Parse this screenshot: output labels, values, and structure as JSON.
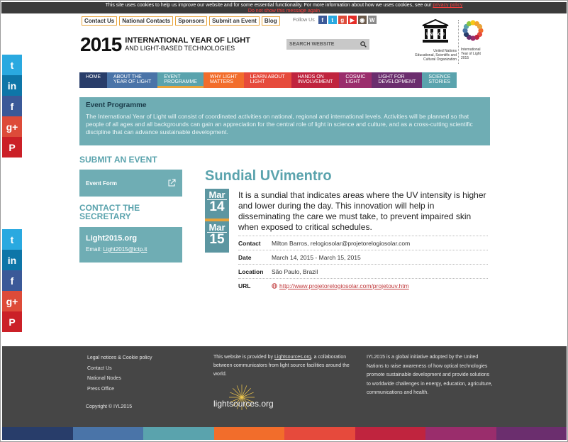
{
  "cookie": {
    "text": "This site uses cookies to help us improve our website and for some essential functionality. For more information about how we uses cookies, see our",
    "policy_link": "privacy policy",
    "dismiss": "Do not show this message again"
  },
  "top_links": [
    "Contact Us",
    "National Contacts",
    "Sponsors",
    "Submit an Event",
    "Blog"
  ],
  "follow": {
    "label": "Follow Us",
    "icons": [
      {
        "name": "facebook-icon",
        "glyph": "f",
        "color": "#3b5998"
      },
      {
        "name": "twitter-icon",
        "glyph": "t",
        "color": "#2aa9e0"
      },
      {
        "name": "google-plus-icon",
        "glyph": "g",
        "color": "#dd4b39"
      },
      {
        "name": "youtube-icon",
        "glyph": "▶",
        "color": "#e52d27"
      },
      {
        "name": "instagram-icon",
        "glyph": "◉",
        "color": "#6b5a4b"
      },
      {
        "name": "wordpress-icon",
        "glyph": "W",
        "color": "#8a8a8a"
      }
    ]
  },
  "logo": {
    "year": "2015",
    "line1": "INTERNATIONAL YEAR OF LIGHT",
    "line2": "AND LIGHT-BASED TECHNOLOGIES"
  },
  "search": {
    "placeholder": "SEARCH WEBSITE"
  },
  "unesco": {
    "word": "UNESCO",
    "caption_1": "United Nations",
    "caption_2": "Educational, Scientific and",
    "caption_3": "Cultural Organization"
  },
  "iyl_logo": {
    "caption_1": "International",
    "caption_2": "Year of Light",
    "caption_3": "2015"
  },
  "nav": [
    {
      "l1": "HOME",
      "l2": "",
      "color": "#283d6a"
    },
    {
      "l1": "ABOUT THE",
      "l2": "YEAR OF LIGHT",
      "color": "#4a74a8"
    },
    {
      "l1": "EVENT",
      "l2": "PROGRAMME",
      "color": "#5aa3ad"
    },
    {
      "l1": "WHY LIGHT",
      "l2": "MATTERS",
      "color": "#f26d2b"
    },
    {
      "l1": "LEARN ABOUT",
      "l2": "LIGHT",
      "color": "#e64a3c"
    },
    {
      "l1": "HANDS ON",
      "l2": "INVOLVEMENT",
      "color": "#c0243e"
    },
    {
      "l1": "COSMIC",
      "l2": "LIGHT",
      "color": "#9a2d6c"
    },
    {
      "l1": "LIGHT FOR",
      "l2": "DEVELOPMENT",
      "color": "#6b2e6e"
    },
    {
      "l1": "SCIENCE",
      "l2": "STORIES",
      "color": "#5aa3ad"
    }
  ],
  "intro": {
    "title": "Event Programme",
    "body": "The International Year of Light will consist of coordinated activities on national, regional and international levels. Activities will be planned so that people of all ages and all backgrounds can gain an appreciation for the central role of light in science and culture, and as a cross-cutting scientific discipline that can advance sustainable development."
  },
  "sidebar": {
    "submit_heading": "SUBMIT AN EVENT",
    "event_form": "Event Form",
    "contact_heading_1": "CONTACT THE",
    "contact_heading_2": "SECRETARY",
    "org_name": "Light2015.org",
    "email_label": "Email:",
    "email": "Light2015@ictp.it"
  },
  "event": {
    "title": "Sundial UVimentro",
    "start_month": "Mar",
    "start_day": "14",
    "end_month": "Mar",
    "end_day": "15",
    "description": "It is a sundial that indicates areas where the UV intensity is higher and lower during the day. This innovation will help in disseminating the care we must take, to prevent impaired skin when exposed to critical schedules.",
    "details": [
      {
        "key": "Contact",
        "value": "Milton Barros, relogiosolar@projetorelogiosolar.com"
      },
      {
        "key": "Date",
        "value": "March 14, 2015 - March 15, 2015"
      },
      {
        "key": "Location",
        "value": "São Paulo, Brazil"
      },
      {
        "key": "URL",
        "value": "http://www.projetorelogiosolar.com/projetouv.htm"
      }
    ]
  },
  "social": [
    {
      "name": "twitter-icon",
      "glyph": "t",
      "color": "#2aa9e0"
    },
    {
      "name": "linkedin-icon",
      "glyph": "in",
      "color": "#0e76a8"
    },
    {
      "name": "facebook-icon",
      "glyph": "f",
      "color": "#3b5998"
    },
    {
      "name": "google-plus-icon",
      "glyph": "g+",
      "color": "#dd4b39"
    },
    {
      "name": "pinterest-icon",
      "glyph": "P",
      "color": "#cb2027"
    }
  ],
  "footer": {
    "links": [
      "Legal notices & Cookie policy",
      "Contact Us",
      "National Nodes",
      "Press Office"
    ],
    "copyright": "Copyright © IYL2015",
    "provided_pre": "This website is provided by",
    "provided_link": "Lightsources.org",
    "provided_post": ", a collaboration between communicators from light source facilities around the world.",
    "lightsources": "lightsources.org",
    "about": "IYL2015 is a global initiative adopted by the United Nations to raise awareness of how optical technologies promote sustainable development and provide solutions to worldwide challenges in energy, education, agriculture, communications and health."
  },
  "stripe_colors": [
    "#283d6a",
    "#4a74a8",
    "#5aa3ad",
    "#f26d2b",
    "#e64a3c",
    "#c0243e",
    "#9a2d6c",
    "#6b2e6e"
  ]
}
